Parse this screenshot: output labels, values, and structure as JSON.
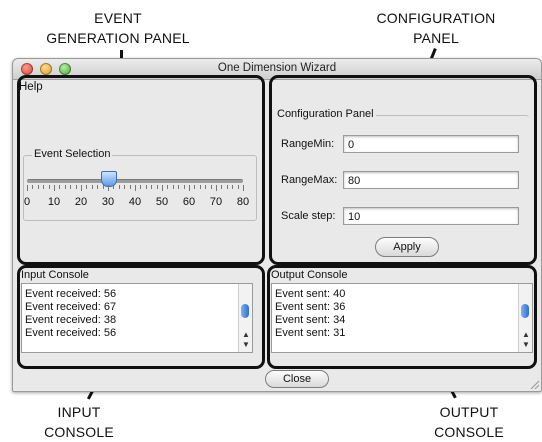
{
  "callouts": {
    "event_generation": [
      "EVENT",
      "GENERATION PANEL"
    ],
    "configuration": [
      "CONFIGURATION",
      "PANEL"
    ],
    "input_console": [
      "INPUT",
      "CONSOLE"
    ],
    "output_console": [
      "OUTPUT",
      "CONSOLE"
    ]
  },
  "window": {
    "title": "One Dimension Wizard"
  },
  "menu": {
    "help": "Help"
  },
  "event_panel": {
    "legend": "Event Selection",
    "slider_value": 30,
    "slider_min": 0,
    "slider_max": 80,
    "ticks": [
      "0",
      "10",
      "20",
      "30",
      "40",
      "50",
      "60",
      "70",
      "80"
    ]
  },
  "config_panel": {
    "legend": "Configuration Panel",
    "range_min_label": "RangeMin:",
    "range_min_value": "0",
    "range_max_label": "RangeMax:",
    "range_max_value": "80",
    "scale_step_label": "Scale step:",
    "scale_step_value": "10",
    "apply_label": "Apply"
  },
  "input_console": {
    "title": "Input Console",
    "lines": [
      "Event received: 56",
      "Event received: 67",
      "Event received: 38",
      "Event received: 56"
    ]
  },
  "output_console": {
    "title": "Output Console",
    "lines": [
      "Event sent: 40",
      "Event sent: 36",
      "Event sent: 34",
      "Event sent: 31"
    ]
  },
  "footer": {
    "close_label": "Close"
  }
}
